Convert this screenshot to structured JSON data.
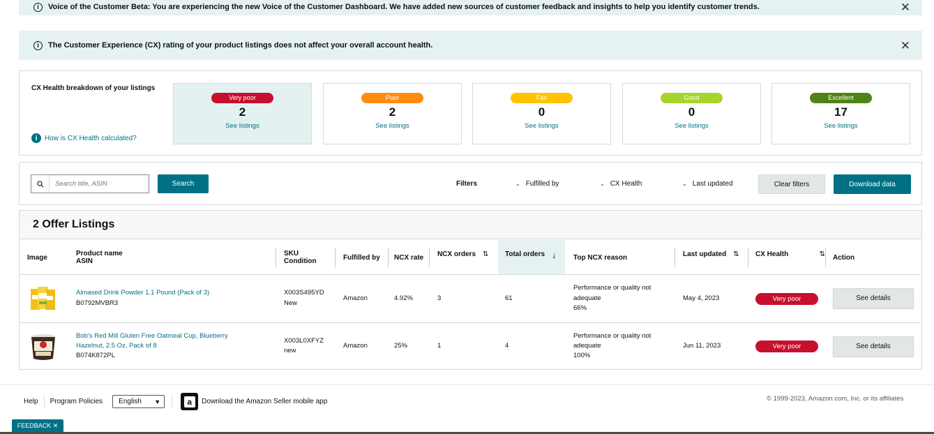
{
  "banners": {
    "beta_text": "Voice of the Customer Beta: You are experiencing the new Voice of the Customer Dashboard. We have added new sources of customer feedback and insights to help you identify customer trends.",
    "cx_text": "The Customer Experience (CX) rating of your product listings does not affect your overall account health.",
    "close_glyph": "✕",
    "info_glyph": "i"
  },
  "cx_health": {
    "title": "CX Health breakdown of your listings",
    "help_link": "How is CX Health calculated?",
    "help_glyph": "i",
    "cards": [
      {
        "label": "Very poor",
        "count": "2",
        "link": "See listings",
        "color": "#c7102e"
      },
      {
        "label": "Poor",
        "count": "2",
        "link": "See listings",
        "color": "#ff8c11"
      },
      {
        "label": "Fair",
        "count": "0",
        "link": "See listings",
        "color": "#ffc400"
      },
      {
        "label": "Good",
        "count": "0",
        "link": "See listings",
        "color": "#a6d42c"
      },
      {
        "label": "Excellent",
        "count": "17",
        "link": "See listings",
        "color": "#4e8316"
      }
    ]
  },
  "filters": {
    "search_placeholder": "Search title, ASIN",
    "search_button": "Search",
    "filters_label": "Filters",
    "fulfilled_by": "Fulfilled by",
    "cx_health": "CX Health",
    "last_updated": "Last updated",
    "clear_button": "Clear filters",
    "download_button": "Download data"
  },
  "table": {
    "heading": "2 Offer Listings",
    "columns": {
      "image": "Image",
      "product_name": "Product name",
      "asin": "ASIN",
      "sku": "SKU",
      "condition": "Condition",
      "fulfilled_by": "Fulfilled by",
      "ncx_rate": "NCX rate",
      "ncx_orders": "NCX orders",
      "total_orders": "Total orders",
      "top_ncx_reason": "Top NCX reason",
      "last_updated": "Last updated",
      "cx_health": "CX Health",
      "action": "Action"
    },
    "rows": [
      {
        "name_line1": "Almased Drink Powder 1.1 Pound (Pack of 3)",
        "name_line2": "",
        "asin": "B0792MVBR3",
        "sku": "X003S495YD",
        "condition": "New",
        "fulfilled_by": "Amazon",
        "ncx_rate": "4.92%",
        "ncx_orders": "3",
        "total_orders": "61",
        "reason_line1": "Performance or quality not",
        "reason_line2": "adequate",
        "reason_pct": "66%",
        "last_updated": "May 4, 2023",
        "cx_health": "Very poor",
        "action": "See details"
      },
      {
        "name_line1": "Bob's Red Mill Gluten Free Oatmeal Cup, Blueberry",
        "name_line2": "Hazelnut, 2.5 Oz, Pack of 8",
        "asin": "B074K872PL",
        "sku": "X003L0XFYZ",
        "condition": "new",
        "fulfilled_by": "Amazon",
        "ncx_rate": "25%",
        "ncx_orders": "1",
        "total_orders": "4",
        "reason_line1": "Performance or quality not",
        "reason_line2": "adequate",
        "reason_pct": "100%",
        "last_updated": "Jun 11, 2023",
        "cx_health": "Very poor",
        "action": "See details"
      }
    ]
  },
  "footer": {
    "help": "Help",
    "program_policies": "Program Policies",
    "language": "English",
    "app_text": "Download the Amazon Seller mobile app",
    "app_glyph": "a",
    "copyright": "© 1999-2023, Amazon.com, Inc. or its affiliates",
    "feedback": "FEEDBACK ✕"
  }
}
